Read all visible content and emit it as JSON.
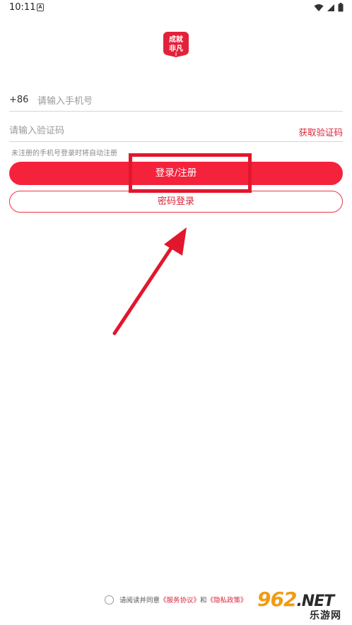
{
  "status_bar": {
    "time": "10:11",
    "notification_icon": "A",
    "icons": [
      "wifi-icon",
      "signal-icon",
      "battery-icon"
    ]
  },
  "logo": {
    "text_line1": "成就",
    "text_line2": "非凡",
    "color": "#e2223a"
  },
  "form": {
    "country_code": "+86",
    "phone_placeholder": "请输入手机号",
    "code_placeholder": "请输入验证码",
    "get_code_label": "获取验证码",
    "hint": "未注册的手机号登录时将自动注册",
    "login_button": "登录/注册",
    "password_login_button": "密码登录"
  },
  "agreement": {
    "prefix": "请阅读并同意",
    "service_link": "《服务协议》",
    "and": "和",
    "privacy_link": "《隐私政策》"
  },
  "watermark": {
    "main": "962",
    "suffix": ".NET",
    "sub": "乐游网"
  },
  "colors": {
    "accent": "#f5223c",
    "link": "#d9253b",
    "annotation": "#e2162c"
  }
}
